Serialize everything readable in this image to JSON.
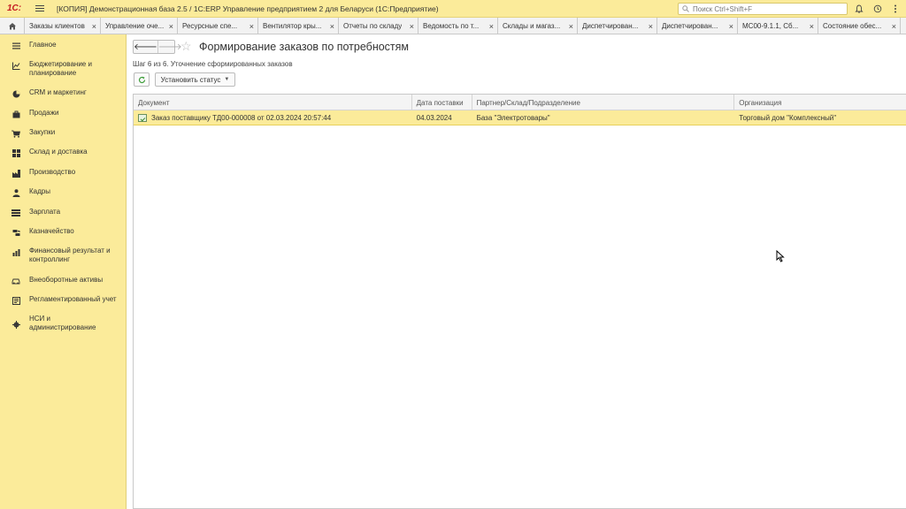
{
  "titlebar": {
    "logo": "1С:",
    "title": "[КОПИЯ] Демонстрационная база 2.5 / 1С:ERP Управление предприятием 2 для Беларуси  (1С:Предприятие)",
    "search_placeholder": "Поиск Ctrl+Shift+F"
  },
  "tabs": [
    {
      "label": "Заказы клиентов"
    },
    {
      "label": "Управление оче..."
    },
    {
      "label": "Ресурсные спе..."
    },
    {
      "label": "Вентилятор кры..."
    },
    {
      "label": "Отчеты по складу"
    },
    {
      "label": "Ведомость по т..."
    },
    {
      "label": "Склады и магаз..."
    },
    {
      "label": "Диспетчирован..."
    },
    {
      "label": "Диспетчирован..."
    },
    {
      "label": "МС00-9.1.1, Сб..."
    },
    {
      "label": "Состояние обес..."
    }
  ],
  "sidebar": {
    "items": [
      {
        "label": "Главное",
        "icon": "menu-icon"
      },
      {
        "label": "Бюджетирование и планирование",
        "icon": "chart-icon"
      },
      {
        "label": "CRM и маркетинг",
        "icon": "pie-icon"
      },
      {
        "label": "Продажи",
        "icon": "bag-icon"
      },
      {
        "label": "Закупки",
        "icon": "cart-icon"
      },
      {
        "label": "Склад и доставка",
        "icon": "warehouse-icon"
      },
      {
        "label": "Производство",
        "icon": "factory-icon"
      },
      {
        "label": "Кадры",
        "icon": "person-icon"
      },
      {
        "label": "Зарплата",
        "icon": "money-icon"
      },
      {
        "label": "Казначейство",
        "icon": "treasury-icon"
      },
      {
        "label": "Финансовый результат и контроллинг",
        "icon": "finance-chart-icon"
      },
      {
        "label": "Внеоборотные активы",
        "icon": "car-icon"
      },
      {
        "label": "Регламентированный учет",
        "icon": "ledger-icon"
      },
      {
        "label": "НСИ и администрирование",
        "icon": "gear-icon"
      }
    ]
  },
  "main": {
    "title": "Формирование заказов по потребностям",
    "step": "Шаг 6 из 6. Уточнение сформированных заказов",
    "set_status_label": "Установить статус",
    "columns": [
      "Документ",
      "Дата поставки",
      "Партнер/Склад/Подразделение",
      "Организация"
    ],
    "rows": [
      {
        "document": "Заказ поставщику ТД00-000008 от 02.03.2024 20:57:44",
        "date": "04.03.2024",
        "partner": "База \"Электротовары\"",
        "organization": "Торговый дом \"Комплексный\""
      }
    ]
  },
  "colors": {
    "accent_yellow": "#fbeb9a",
    "logo_red": "#c61e24",
    "refresh_green": "#3a9c36"
  }
}
